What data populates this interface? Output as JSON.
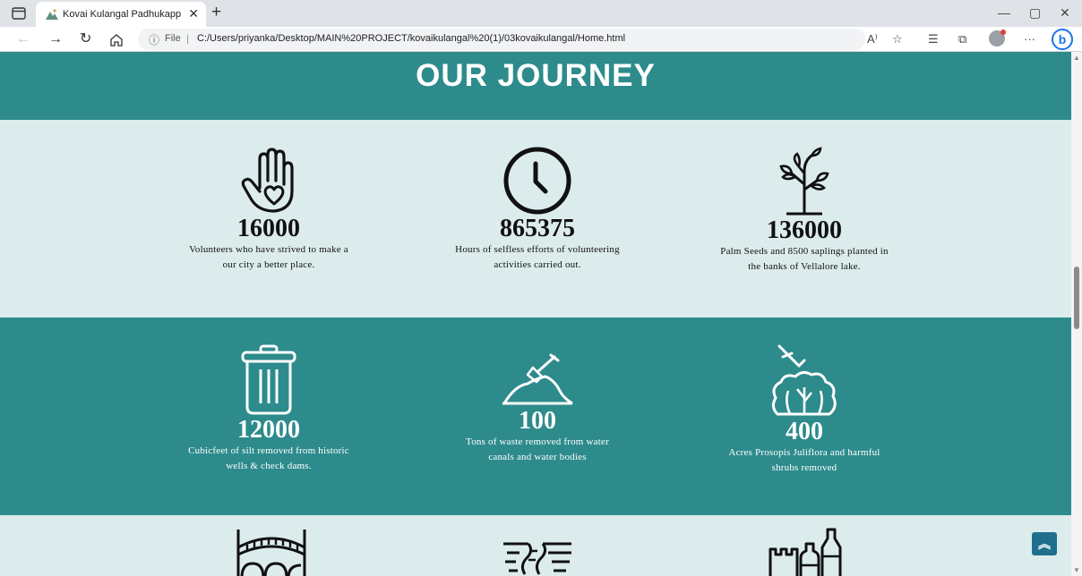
{
  "browser": {
    "tab_title": "Kovai Kulangal Padhukappu Amaipp",
    "url_label": "File",
    "url": "C:/Users/priyanka/Desktop/MAIN%20PROJECT/kovaikulangal%20(1)/03kovaikulangal/Home.html",
    "read_aloud": "A⁾"
  },
  "page": {
    "heading": "OUR JOURNEY",
    "stats_row1": [
      {
        "number": "16000",
        "line1": "Volunteers who have strived to make a",
        "line2": "our city a better place."
      },
      {
        "number": "865375",
        "line1": "Hours of selfless efforts of volunteering",
        "line2": "activities carried out."
      },
      {
        "number": "136000",
        "line1": "Palm Seeds and 8500 saplings planted in",
        "line2": "the banks of Vellalore lake."
      }
    ],
    "stats_row2": [
      {
        "number": "12000",
        "line1": "Cubicfeet of silt removed from historic",
        "line2": "wells & check dams."
      },
      {
        "number": "100",
        "line1": "Tons of waste removed from water",
        "line2": "canals and water bodies"
      },
      {
        "number": "400",
        "line1": "Acres Prosopis Juliflora and harmful",
        "line2": "shrubs removed"
      }
    ]
  },
  "colors": {
    "teal": "#2e8b8c",
    "light": "#dcecec",
    "back_to_top": "#1e6f8e"
  }
}
